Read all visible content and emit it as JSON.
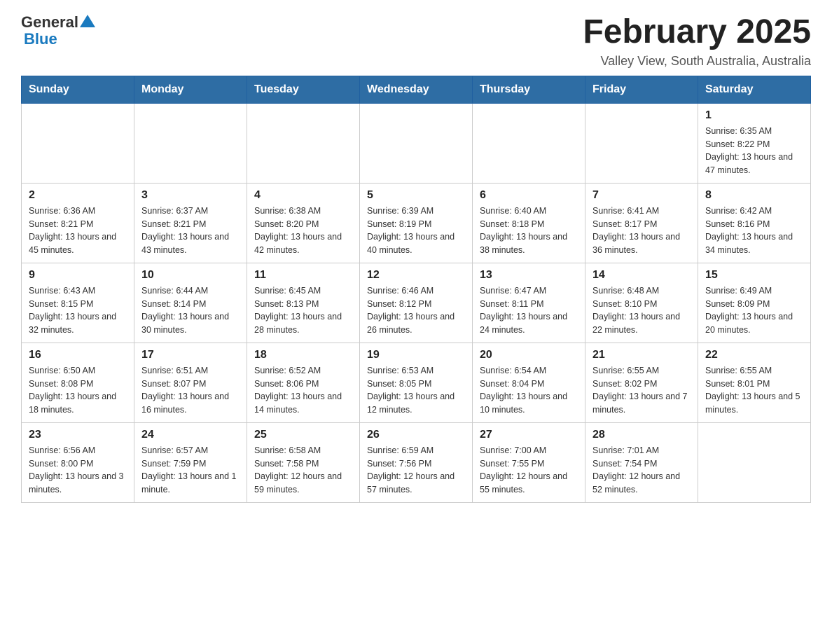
{
  "header": {
    "logo_general": "General",
    "logo_blue": "Blue",
    "title": "February 2025",
    "location": "Valley View, South Australia, Australia"
  },
  "days_of_week": [
    "Sunday",
    "Monday",
    "Tuesday",
    "Wednesday",
    "Thursday",
    "Friday",
    "Saturday"
  ],
  "weeks": [
    {
      "days": [
        {
          "num": "",
          "info": ""
        },
        {
          "num": "",
          "info": ""
        },
        {
          "num": "",
          "info": ""
        },
        {
          "num": "",
          "info": ""
        },
        {
          "num": "",
          "info": ""
        },
        {
          "num": "",
          "info": ""
        },
        {
          "num": "1",
          "info": "Sunrise: 6:35 AM\nSunset: 8:22 PM\nDaylight: 13 hours and 47 minutes."
        }
      ]
    },
    {
      "days": [
        {
          "num": "2",
          "info": "Sunrise: 6:36 AM\nSunset: 8:21 PM\nDaylight: 13 hours and 45 minutes."
        },
        {
          "num": "3",
          "info": "Sunrise: 6:37 AM\nSunset: 8:21 PM\nDaylight: 13 hours and 43 minutes."
        },
        {
          "num": "4",
          "info": "Sunrise: 6:38 AM\nSunset: 8:20 PM\nDaylight: 13 hours and 42 minutes."
        },
        {
          "num": "5",
          "info": "Sunrise: 6:39 AM\nSunset: 8:19 PM\nDaylight: 13 hours and 40 minutes."
        },
        {
          "num": "6",
          "info": "Sunrise: 6:40 AM\nSunset: 8:18 PM\nDaylight: 13 hours and 38 minutes."
        },
        {
          "num": "7",
          "info": "Sunrise: 6:41 AM\nSunset: 8:17 PM\nDaylight: 13 hours and 36 minutes."
        },
        {
          "num": "8",
          "info": "Sunrise: 6:42 AM\nSunset: 8:16 PM\nDaylight: 13 hours and 34 minutes."
        }
      ]
    },
    {
      "days": [
        {
          "num": "9",
          "info": "Sunrise: 6:43 AM\nSunset: 8:15 PM\nDaylight: 13 hours and 32 minutes."
        },
        {
          "num": "10",
          "info": "Sunrise: 6:44 AM\nSunset: 8:14 PM\nDaylight: 13 hours and 30 minutes."
        },
        {
          "num": "11",
          "info": "Sunrise: 6:45 AM\nSunset: 8:13 PM\nDaylight: 13 hours and 28 minutes."
        },
        {
          "num": "12",
          "info": "Sunrise: 6:46 AM\nSunset: 8:12 PM\nDaylight: 13 hours and 26 minutes."
        },
        {
          "num": "13",
          "info": "Sunrise: 6:47 AM\nSunset: 8:11 PM\nDaylight: 13 hours and 24 minutes."
        },
        {
          "num": "14",
          "info": "Sunrise: 6:48 AM\nSunset: 8:10 PM\nDaylight: 13 hours and 22 minutes."
        },
        {
          "num": "15",
          "info": "Sunrise: 6:49 AM\nSunset: 8:09 PM\nDaylight: 13 hours and 20 minutes."
        }
      ]
    },
    {
      "days": [
        {
          "num": "16",
          "info": "Sunrise: 6:50 AM\nSunset: 8:08 PM\nDaylight: 13 hours and 18 minutes."
        },
        {
          "num": "17",
          "info": "Sunrise: 6:51 AM\nSunset: 8:07 PM\nDaylight: 13 hours and 16 minutes."
        },
        {
          "num": "18",
          "info": "Sunrise: 6:52 AM\nSunset: 8:06 PM\nDaylight: 13 hours and 14 minutes."
        },
        {
          "num": "19",
          "info": "Sunrise: 6:53 AM\nSunset: 8:05 PM\nDaylight: 13 hours and 12 minutes."
        },
        {
          "num": "20",
          "info": "Sunrise: 6:54 AM\nSunset: 8:04 PM\nDaylight: 13 hours and 10 minutes."
        },
        {
          "num": "21",
          "info": "Sunrise: 6:55 AM\nSunset: 8:02 PM\nDaylight: 13 hours and 7 minutes."
        },
        {
          "num": "22",
          "info": "Sunrise: 6:55 AM\nSunset: 8:01 PM\nDaylight: 13 hours and 5 minutes."
        }
      ]
    },
    {
      "days": [
        {
          "num": "23",
          "info": "Sunrise: 6:56 AM\nSunset: 8:00 PM\nDaylight: 13 hours and 3 minutes."
        },
        {
          "num": "24",
          "info": "Sunrise: 6:57 AM\nSunset: 7:59 PM\nDaylight: 13 hours and 1 minute."
        },
        {
          "num": "25",
          "info": "Sunrise: 6:58 AM\nSunset: 7:58 PM\nDaylight: 12 hours and 59 minutes."
        },
        {
          "num": "26",
          "info": "Sunrise: 6:59 AM\nSunset: 7:56 PM\nDaylight: 12 hours and 57 minutes."
        },
        {
          "num": "27",
          "info": "Sunrise: 7:00 AM\nSunset: 7:55 PM\nDaylight: 12 hours and 55 minutes."
        },
        {
          "num": "28",
          "info": "Sunrise: 7:01 AM\nSunset: 7:54 PM\nDaylight: 12 hours and 52 minutes."
        },
        {
          "num": "",
          "info": ""
        }
      ]
    }
  ]
}
